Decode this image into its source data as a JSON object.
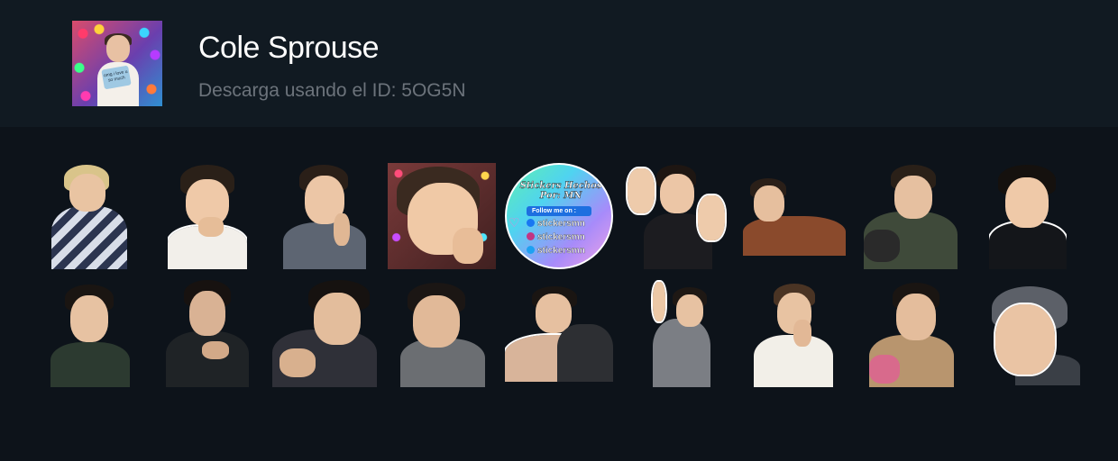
{
  "pack": {
    "title": "Cole Sprouse",
    "subtitle": "Descarga usando el ID: 5OG5N",
    "cover_sign_text": "omg i love u so much"
  },
  "promo_sticker": {
    "title": "Stickers Hechos Por: MN",
    "follow_label": "Follow me on :",
    "handles": [
      "stickersmn",
      "stickersmn",
      "stickersmn"
    ],
    "icon_names": [
      "facebook-icon",
      "instagram-icon",
      "twitter-icon"
    ]
  },
  "watermark": "MN",
  "colors": {
    "page_bg": "#0d131a",
    "header_bg": "#111a22",
    "title": "#ffffff",
    "subtitle": "#6c737b"
  }
}
